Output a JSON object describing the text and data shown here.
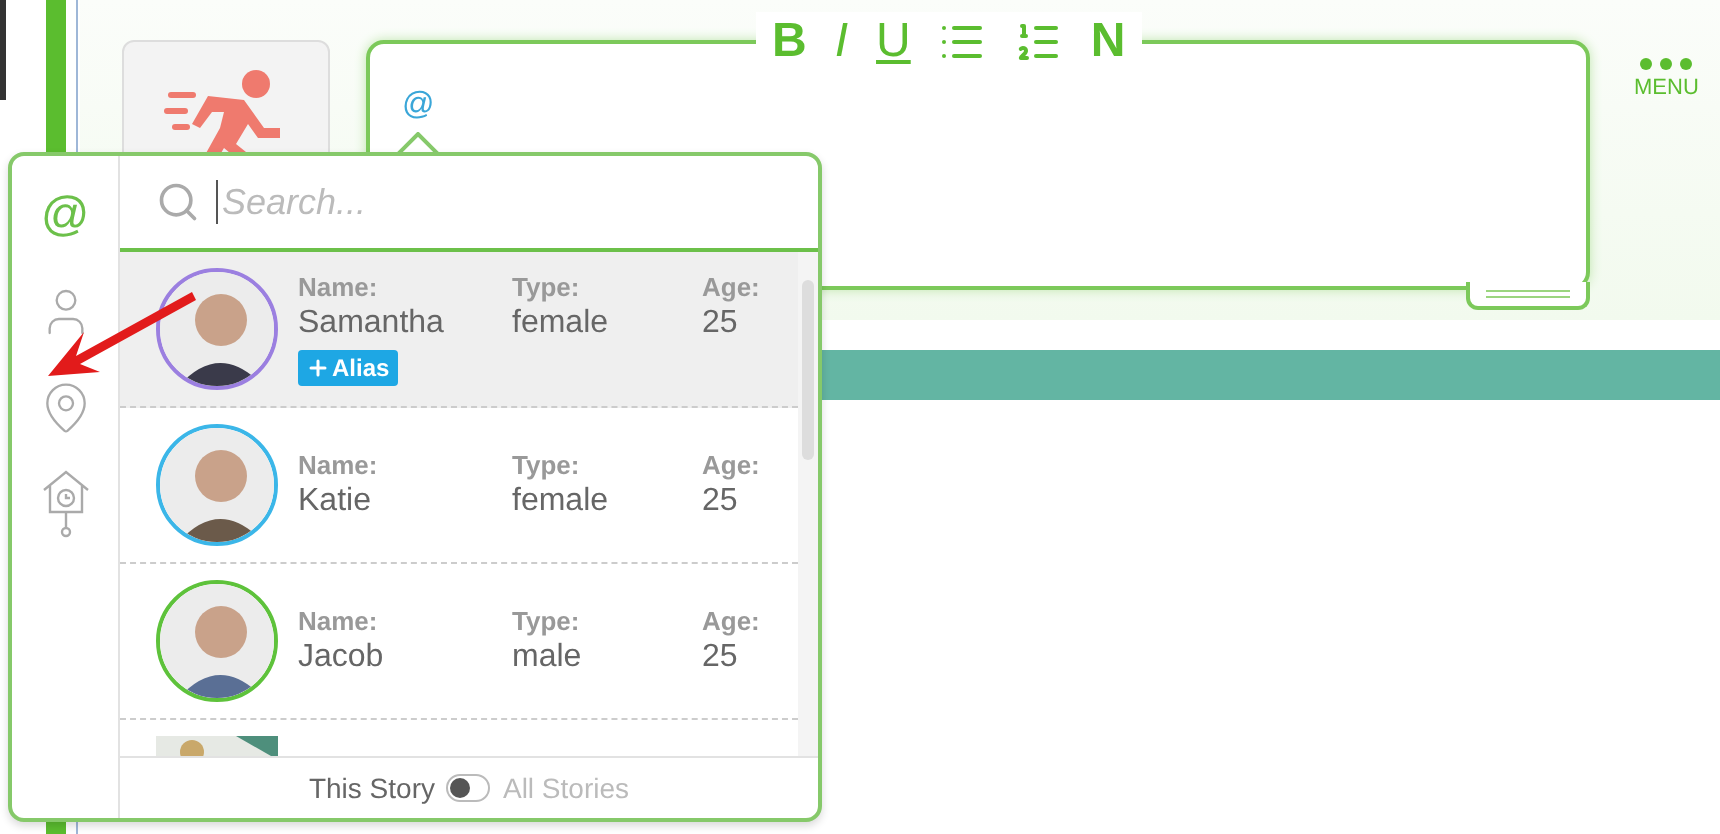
{
  "editor": {
    "text": "@",
    "toolbar": [
      {
        "kind": "bold",
        "label": "B"
      },
      {
        "kind": "italic",
        "label": "I"
      },
      {
        "kind": "underline",
        "label": "U"
      },
      {
        "kind": "bullets"
      },
      {
        "kind": "numbers"
      },
      {
        "kind": "normal",
        "label": "N"
      }
    ]
  },
  "menu": {
    "label": "MENU"
  },
  "mention_popup": {
    "tabs": [
      {
        "kind": "mention",
        "label": "@",
        "selected": true
      },
      {
        "kind": "character",
        "selected": false
      },
      {
        "kind": "place",
        "selected": false
      },
      {
        "kind": "time",
        "selected": false
      }
    ],
    "search": {
      "placeholder": "Search..."
    },
    "rows": [
      {
        "kind": "person",
        "selected": true,
        "color": "#9b7fe0",
        "fields": [
          {
            "label": "Name:",
            "value": "Samantha"
          },
          {
            "label": "Type:",
            "value": "female"
          },
          {
            "label": "Age:",
            "value": "25"
          }
        ],
        "alias": "Alias"
      },
      {
        "kind": "person",
        "selected": false,
        "color": "#3bb6e8",
        "fields": [
          {
            "label": "Name:",
            "value": "Katie"
          },
          {
            "label": "Type:",
            "value": "female"
          },
          {
            "label": "Age:",
            "value": "25"
          }
        ]
      },
      {
        "kind": "person",
        "selected": false,
        "color": "#5ec23b",
        "fields": [
          {
            "label": "Name:",
            "value": "Jacob"
          },
          {
            "label": "Type:",
            "value": "male"
          },
          {
            "label": "Age:",
            "value": "25"
          }
        ]
      },
      {
        "kind": "picture"
      }
    ],
    "scope": {
      "left": "This Story",
      "right": "All Stories",
      "on": false
    }
  }
}
